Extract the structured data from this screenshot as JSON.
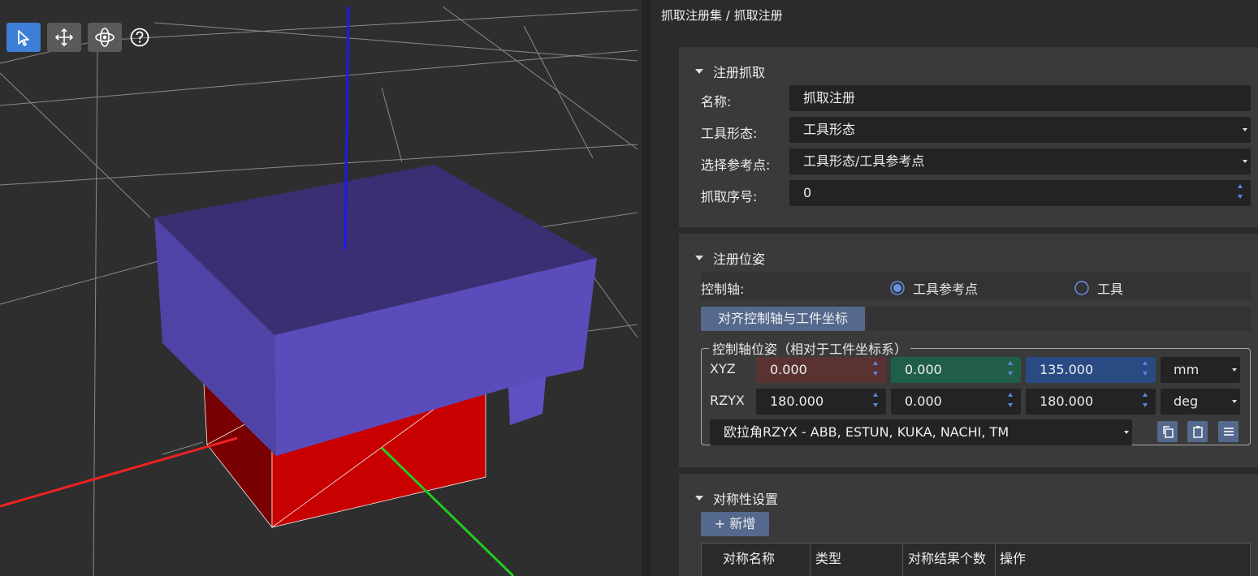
{
  "breadcrumb": "抓取注册集 / 抓取注册",
  "viewport_toolbar": {
    "icons": [
      "select-pointer-icon",
      "move-arrows-icon",
      "orbit-icon",
      "help-icon"
    ]
  },
  "section_register": {
    "title": "注册抓取",
    "name_label": "名称:",
    "name_value": "抓取注册",
    "tool_shape_label": "工具形态:",
    "tool_shape_value": "工具形态",
    "ref_point_label": "选择参考点:",
    "ref_point_value": "工具形态/工具参考点",
    "grab_index_label": "抓取序号:",
    "grab_index_value": "0"
  },
  "section_pose": {
    "title": "注册位姿",
    "control_axis_label": "控制轴:",
    "radio_ref_point": "工具参考点",
    "radio_tool": "工具",
    "radio_selected": "工具参考点",
    "align_button": "对齐控制轴与工件坐标",
    "group_title": "控制轴位姿（相对于工件坐标系）",
    "xyz_label": "XYZ",
    "xyz_values": [
      "0.000",
      "0.000",
      "135.000"
    ],
    "xyz_unit": "mm",
    "rzyx_label": "RZYX",
    "rzyx_values": [
      "180.000",
      "0.000",
      "180.000"
    ],
    "rzyx_unit": "deg",
    "euler_convention": "欧拉角RZYX - ABB, ESTUN, KUKA, NACHI, TM",
    "colors": {
      "x": "#5a3232",
      "y": "#215e48",
      "z": "#2a4a83"
    }
  },
  "section_symmetry": {
    "title": "对称性设置",
    "add_button": "+ 新增",
    "columns": [
      "对称名称",
      "类型",
      "对称结果个数",
      "操作"
    ]
  }
}
